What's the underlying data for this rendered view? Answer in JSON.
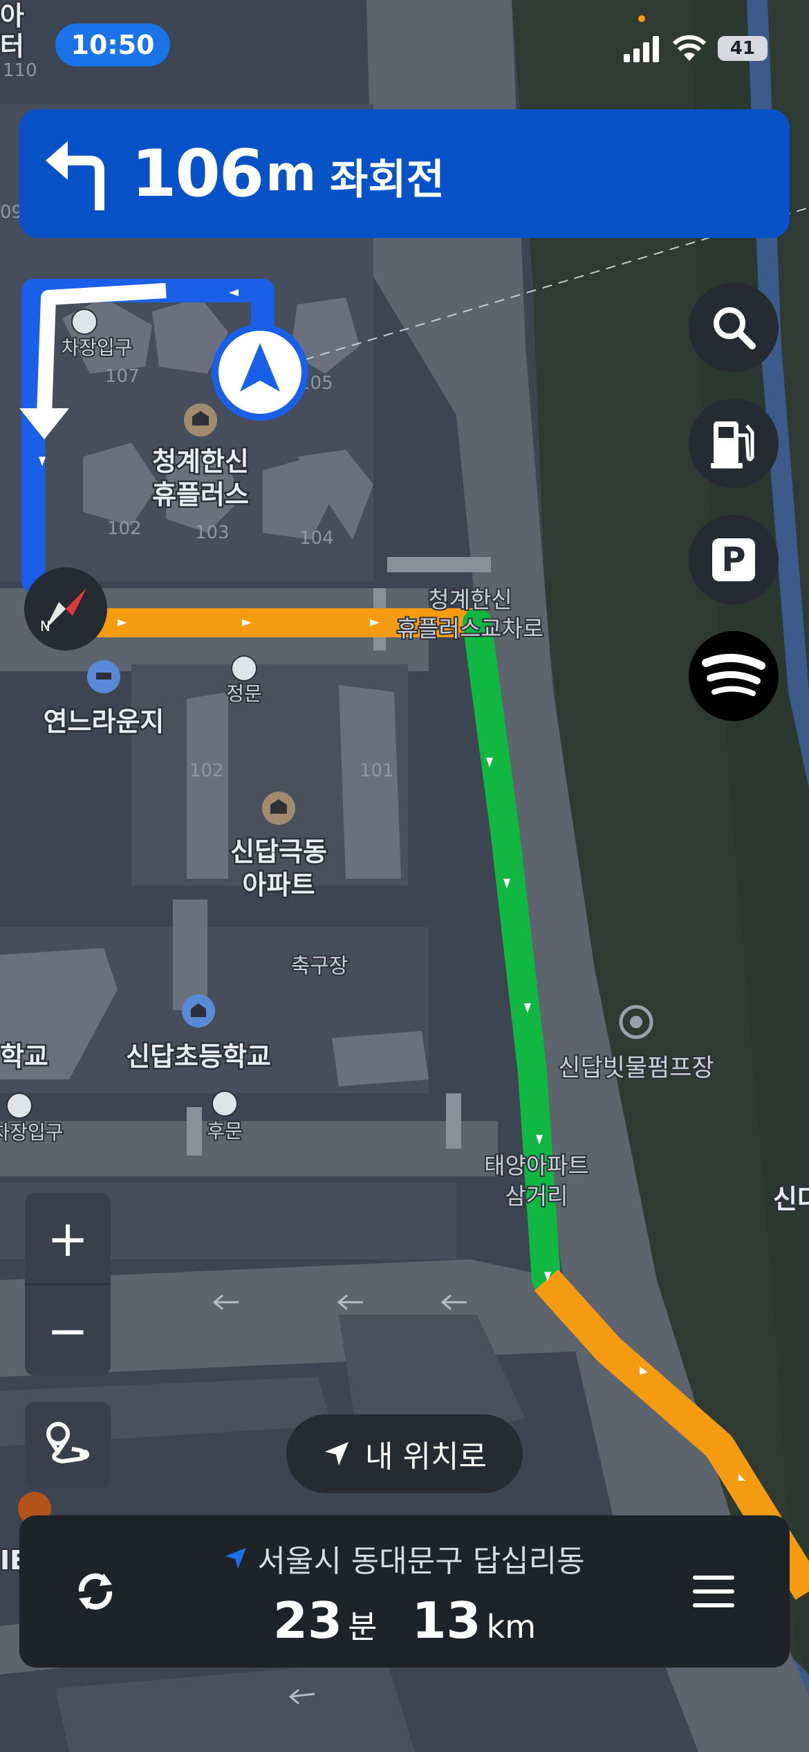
{
  "status_bar": {
    "time": "10:50",
    "battery": "41",
    "icons": [
      "signal-icon",
      "wifi-icon",
      "battery-icon"
    ]
  },
  "guidance": {
    "direction_icon": "turn-left-arrow-icon",
    "distance": "106",
    "unit": "m",
    "instruction": "좌회전"
  },
  "map_labels": {
    "apt1_line1": "청계한신",
    "apt1_line2": "휴플러스",
    "apt2_line1": "신답극동",
    "apt2_line2": "아파트",
    "lounge": "연느라운지",
    "school": "신답초등학교",
    "school_left": "학교",
    "field": "축구장",
    "gate": "정문",
    "back_gate": "후문",
    "parking_entrance": "차장입구",
    "parking_entrance2": "차장입구",
    "intersection1_line1": "청계한신",
    "intersection1_line2": "휴플러스교차로",
    "intersection2_line1": "태양아파트",
    "intersection2_line2": "삼거리",
    "pump": "신답빗물펌프장",
    "edge_right": "신다",
    "edge_left": "IE",
    "top_left_1": "아",
    "top_left_2": "터",
    "building_numbers": [
      "110",
      "107",
      "105",
      "102",
      "103",
      "104",
      "102",
      "101",
      "102",
      "09",
      "1"
    ]
  },
  "right_buttons": [
    {
      "name": "search-button",
      "icon": "search-icon"
    },
    {
      "name": "gas-station-button",
      "icon": "gas-pump-icon"
    },
    {
      "name": "parking-button",
      "icon": "parking-icon",
      "label": "P"
    },
    {
      "name": "spotify-button",
      "icon": "spotify-icon"
    }
  ],
  "map_controls": {
    "zoom_in": "+",
    "zoom_out": "−",
    "locate_label": "내 위치로"
  },
  "trip": {
    "destination": "서울시 동대문구 답십리동",
    "eta_minutes": "23",
    "minutes_unit": "분",
    "distance": "13",
    "distance_unit": "km"
  },
  "colors": {
    "route_blue": "#1a5fe8",
    "route_orange": "#f59b12",
    "route_green": "#10b740",
    "banner": "#0652c6",
    "accent": "#1a73e8"
  }
}
